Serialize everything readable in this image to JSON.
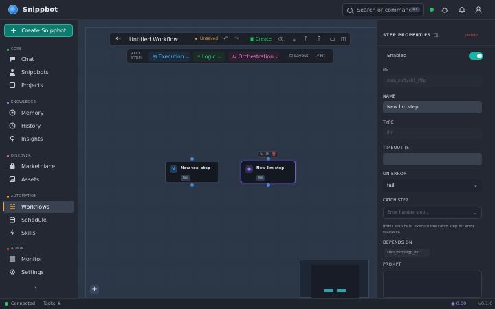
{
  "app": {
    "name": "Snippbot"
  },
  "topbar": {
    "search_placeholder": "Search or command...",
    "search_kbd": "⌘K"
  },
  "sidebar": {
    "create_label": "Create Snippbot",
    "sections": [
      {
        "label": "CORE",
        "color": "#22c55e"
      },
      {
        "label": "KNOWLEDGE",
        "color": "#a78bfa"
      },
      {
        "label": "DISCOVER",
        "color": "#f472b6"
      },
      {
        "label": "AUTOMATION",
        "color": "#f59e0b"
      },
      {
        "label": "ADMIN",
        "color": "#ef4444"
      }
    ],
    "items": [
      {
        "label": "Chat",
        "icon": "chat-icon"
      },
      {
        "label": "Snippbots",
        "icon": "person-icon"
      },
      {
        "label": "Projects",
        "icon": "square-icon"
      },
      {
        "label": "Memory",
        "icon": "brain-icon"
      },
      {
        "label": "History",
        "icon": "clock-icon"
      },
      {
        "label": "Insights",
        "icon": "bulb-icon"
      },
      {
        "label": "Marketplace",
        "icon": "bag-icon"
      },
      {
        "label": "Assets",
        "icon": "image-icon"
      },
      {
        "label": "Workflows",
        "icon": "workflow-icon",
        "active": true
      },
      {
        "label": "Schedule",
        "icon": "calendar-icon"
      },
      {
        "label": "Skills",
        "icon": "bolt-icon"
      },
      {
        "label": "Monitor",
        "icon": "monitor-icon"
      },
      {
        "label": "Settings",
        "icon": "gear-icon"
      }
    ]
  },
  "workflow": {
    "title": "Untitled Workflow",
    "unsaved_label": "Unsaved",
    "create_label": "Create",
    "add_step_label": "ADD STEP:",
    "step_types": [
      "Execution",
      "Logic",
      "Orchestration"
    ],
    "layout_label": "Layout",
    "fit_label": "Fit",
    "nodes": [
      {
        "title": "New tool step",
        "tag": "tool"
      },
      {
        "title": "New llm step",
        "tag": "llm"
      }
    ]
  },
  "properties": {
    "title": "STEP PROPERTIES",
    "delete_label": "Delete",
    "enabled_label": "Enabled",
    "enabled": true,
    "id_label": "ID",
    "id_value": "step_mdtyslj1_rfjlp",
    "name_label": "NAME",
    "name_value": "New llm step",
    "type_label": "TYPE",
    "type_value": "llm",
    "timeout_label": "TIMEOUT (S)",
    "timeout_value": "",
    "on_error_label": "ON ERROR",
    "on_error_value": "fail",
    "catch_label": "CATCH STEP",
    "catch_placeholder": "Error handler step...",
    "catch_hint": "If this step fails, execute the catch step for error recovery.",
    "depends_label": "DEPENDS ON",
    "depends_value": "step_mdtyslgp_flnf",
    "prompt_label": "PROMPT"
  },
  "statusbar": {
    "connected": "Connected",
    "tasks": "Tasks: 6",
    "credits": "0.00",
    "version": "v0.1.0"
  }
}
